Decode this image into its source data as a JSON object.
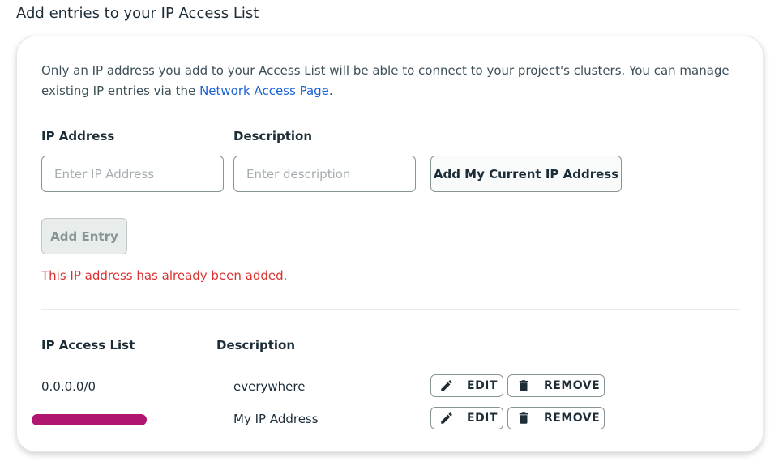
{
  "page": {
    "title": "Add entries to your IP Access List"
  },
  "intro": {
    "text_before": "Only an IP address you add to your Access List will be able to connect to your project's clusters. You can manage existing IP entries via the ",
    "link_text": "Network Access Page",
    "text_after": "."
  },
  "form": {
    "ip_label": "IP Address",
    "ip_placeholder": "Enter IP Address",
    "ip_value": "",
    "desc_label": "Description",
    "desc_placeholder": "Enter description",
    "desc_value": "",
    "current_ip_button": "Add My Current IP Address",
    "add_entry_button": "Add Entry",
    "error": "This IP address has already been added."
  },
  "list": {
    "col_ip": "IP Access List",
    "col_desc": "Description",
    "edit_label": "EDIT",
    "remove_label": "REMOVE",
    "rows": [
      {
        "ip": "0.0.0.0/0",
        "description": "everywhere"
      },
      {
        "ip": "",
        "description": "My IP Address",
        "ip_redacted": true
      }
    ]
  },
  "colors": {
    "link": "#1a64d6",
    "error": "#db3030",
    "redaction": "#b0156f"
  },
  "icons": [
    "pencil-icon",
    "trash-icon"
  ]
}
